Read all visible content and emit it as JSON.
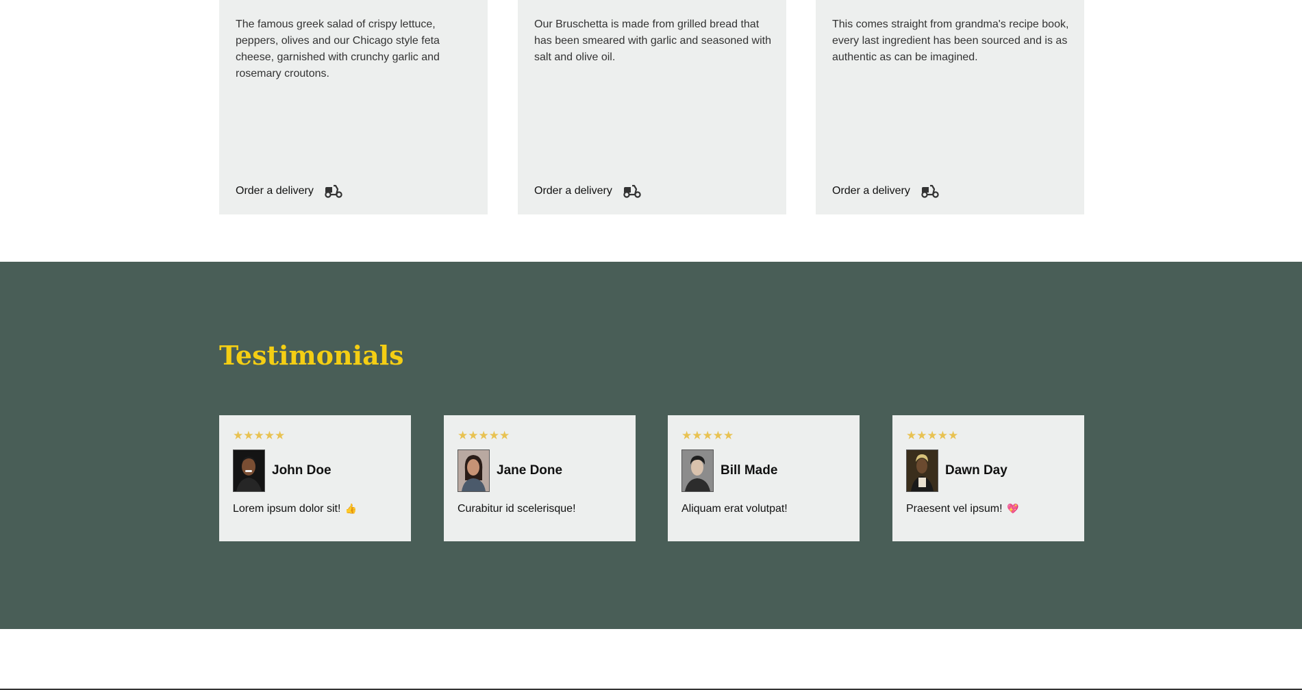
{
  "specials": [
    {
      "description": "The famous greek salad of crispy lettuce, peppers, olives and our Chicago style feta cheese, garnished with crunchy garlic and rosemary croutons.",
      "order_label": "Order a delivery",
      "icon": "scooter-icon"
    },
    {
      "description": "Our Bruschetta is made from grilled bread that has been smeared with garlic and seasoned with salt and olive oil.",
      "order_label": "Order a delivery",
      "icon": "scooter-icon"
    },
    {
      "description": "This comes straight from grandma's recipe book, every last ingredient has been sourced and is as authentic as can be imagined.",
      "order_label": "Order a delivery",
      "icon": "scooter-icon"
    }
  ],
  "testimonials": {
    "title": "Testimonials",
    "cards": [
      {
        "rating": "★★★★★",
        "name": "John Doe",
        "quote": "Lorem ipsum dolor sit!",
        "emoji": "👍"
      },
      {
        "rating": "★★★★★",
        "name": "Jane Done",
        "quote": "Curabitur id scelerisque!",
        "emoji": ""
      },
      {
        "rating": "★★★★★",
        "name": "Bill Made",
        "quote": "Aliquam erat volutpat!",
        "emoji": ""
      },
      {
        "rating": "★★★★★",
        "name": "Dawn Day",
        "quote": "Praesent vel ipsum!",
        "emoji": "💖"
      }
    ]
  },
  "colors": {
    "primary_green": "#495e57",
    "primary_yellow": "#f4ce14",
    "card_bg": "#edefee",
    "star": "#e8c252"
  }
}
